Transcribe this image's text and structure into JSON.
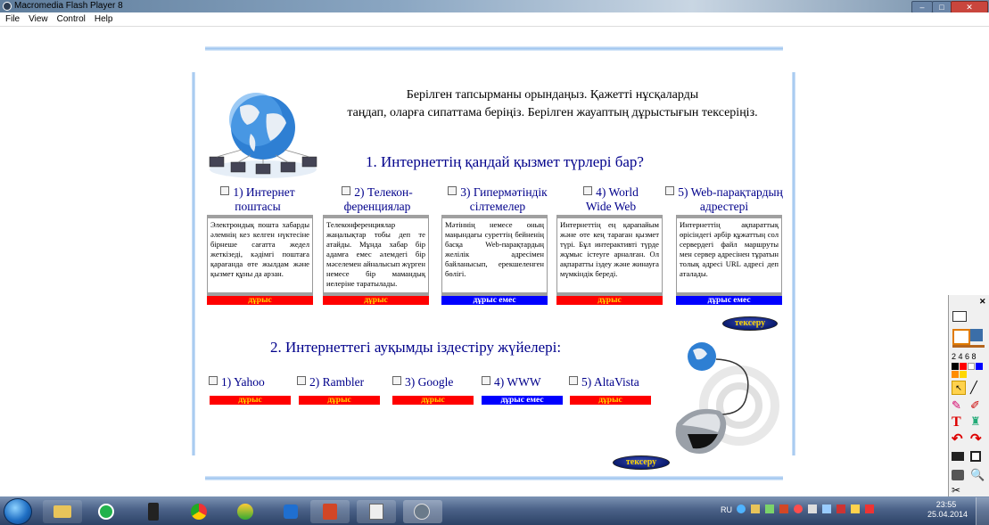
{
  "window": {
    "title": "Macromedia Flash Player 8",
    "controls": [
      "–",
      "□",
      "✕"
    ]
  },
  "menu": [
    "File",
    "View",
    "Control",
    "Help"
  ],
  "intro": {
    "line1": "Берілген тапсырманы орындаңыз. Қажетті нұсқаларды",
    "line2": "таңдап, оларға сипаттама беріңіз. Берілген жауаптың дұрыстығын тексеріңіз."
  },
  "q1": {
    "title": "1. Интернеттің қандай қызмет түрлері бар?",
    "options": [
      {
        "label1": "1) Интернет",
        "label2": "поштасы",
        "desc": "Электрондық пошта хабарды әлемнің кез келген нүктесіне бірнеше сағатта жедел жеткізеді, кәдімгі поштаға қарағанда өте жылдам және қызмет құны да арзан.",
        "result": "дұрыс",
        "status": "red"
      },
      {
        "label1": "2) Телекон-",
        "label2": "ференциялар",
        "desc": "Телеконференциялар жаңалықтар тобы деп те атайды. Мұнда хабар бір адамға емес әлемдегі бір мәселемен айналысып жүрген немесе бір мамандық иелеріне таратылады.",
        "result": "дұрыс",
        "status": "red"
      },
      {
        "label1": "3) Гипермәтіндік",
        "label2": "сілтемелер",
        "desc": "Мәтіннің немесе оның маңындағы суреттің бейненің басқа Web-парақтардың желілік адресімен байланысып, ерекшеленген бөлігі.",
        "result": "дұрыс емес",
        "status": "blue"
      },
      {
        "label1": "4) World",
        "label2": "Wide Web",
        "desc": "Интернеттің ең қарапайым және өте кең тараған қызмет түрі. Бұл интерактивті түрде жұмыс істеуге арналған. Ол ақпаратты іздеу және жинауға мүмкіндік береді.",
        "result": "дұрыс",
        "status": "red"
      },
      {
        "label1": "5) Web-парақтардың",
        "label2": "адрестері",
        "desc": "Интернеттің ақпараттық өрісіндегі әрбір құжаттың сол сервердегі файл маршруты мен сервер адресінен тұратын толық адресі URL адресі деп аталады.",
        "result": "дұрыс емес",
        "status": "blue"
      }
    ],
    "check_label": "тексеру"
  },
  "q2": {
    "title": "2. Интернеттегі ауқымды іздестіру жүйелері:",
    "options": [
      {
        "label": "1) Yahoo",
        "result": "дұрыс",
        "status": "red"
      },
      {
        "label": "2) Rambler",
        "result": "дұрыс",
        "status": "red"
      },
      {
        "label": "3)  Google",
        "result": "дұрыс",
        "status": "red"
      },
      {
        "label": "4) WWW",
        "result": "дұрыс емес",
        "status": "blue"
      },
      {
        "label": "5) AltaVista",
        "result": "дұрыс",
        "status": "red"
      }
    ],
    "check_label": "тексеру"
  },
  "toolbox": {
    "numbers": "2  4  6  8",
    "close": "✕"
  },
  "taskbar": {
    "lang": "RU",
    "time": "23:55",
    "date": "25.04.2014"
  },
  "colors": {
    "correct": "#ff0000",
    "incorrect": "#0000ff",
    "title": "#00008b"
  }
}
